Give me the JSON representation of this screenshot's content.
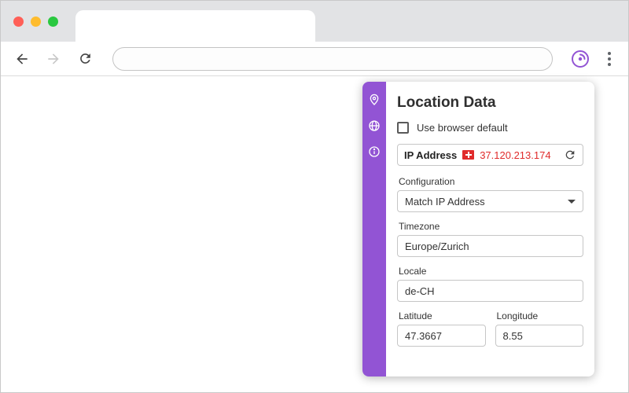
{
  "window": {
    "traffic_light_colors": {
      "close": "#ff5f57",
      "minimize": "#febc2e",
      "zoom": "#2ac840"
    }
  },
  "toolbar": {
    "address_value": ""
  },
  "panel": {
    "title": "Location Data",
    "checkbox": {
      "label": "Use browser default",
      "checked": false
    },
    "ip": {
      "label": "IP Address",
      "value": "37.120.213.174",
      "flag": "swiss-flag"
    },
    "configuration": {
      "label": "Configuration",
      "value": "Match IP Address"
    },
    "timezone": {
      "label": "Timezone",
      "value": "Europe/Zurich"
    },
    "locale": {
      "label": "Locale",
      "value": "de-CH"
    },
    "latitude": {
      "label": "Latitude",
      "value": "47.3667"
    },
    "longitude": {
      "label": "Longitude",
      "value": "8.55"
    },
    "sidebar_icons": [
      "location-icon",
      "globe-icon",
      "info-icon"
    ],
    "colors": {
      "accent": "#9254d4",
      "ip_value": "#e02b2b"
    }
  }
}
